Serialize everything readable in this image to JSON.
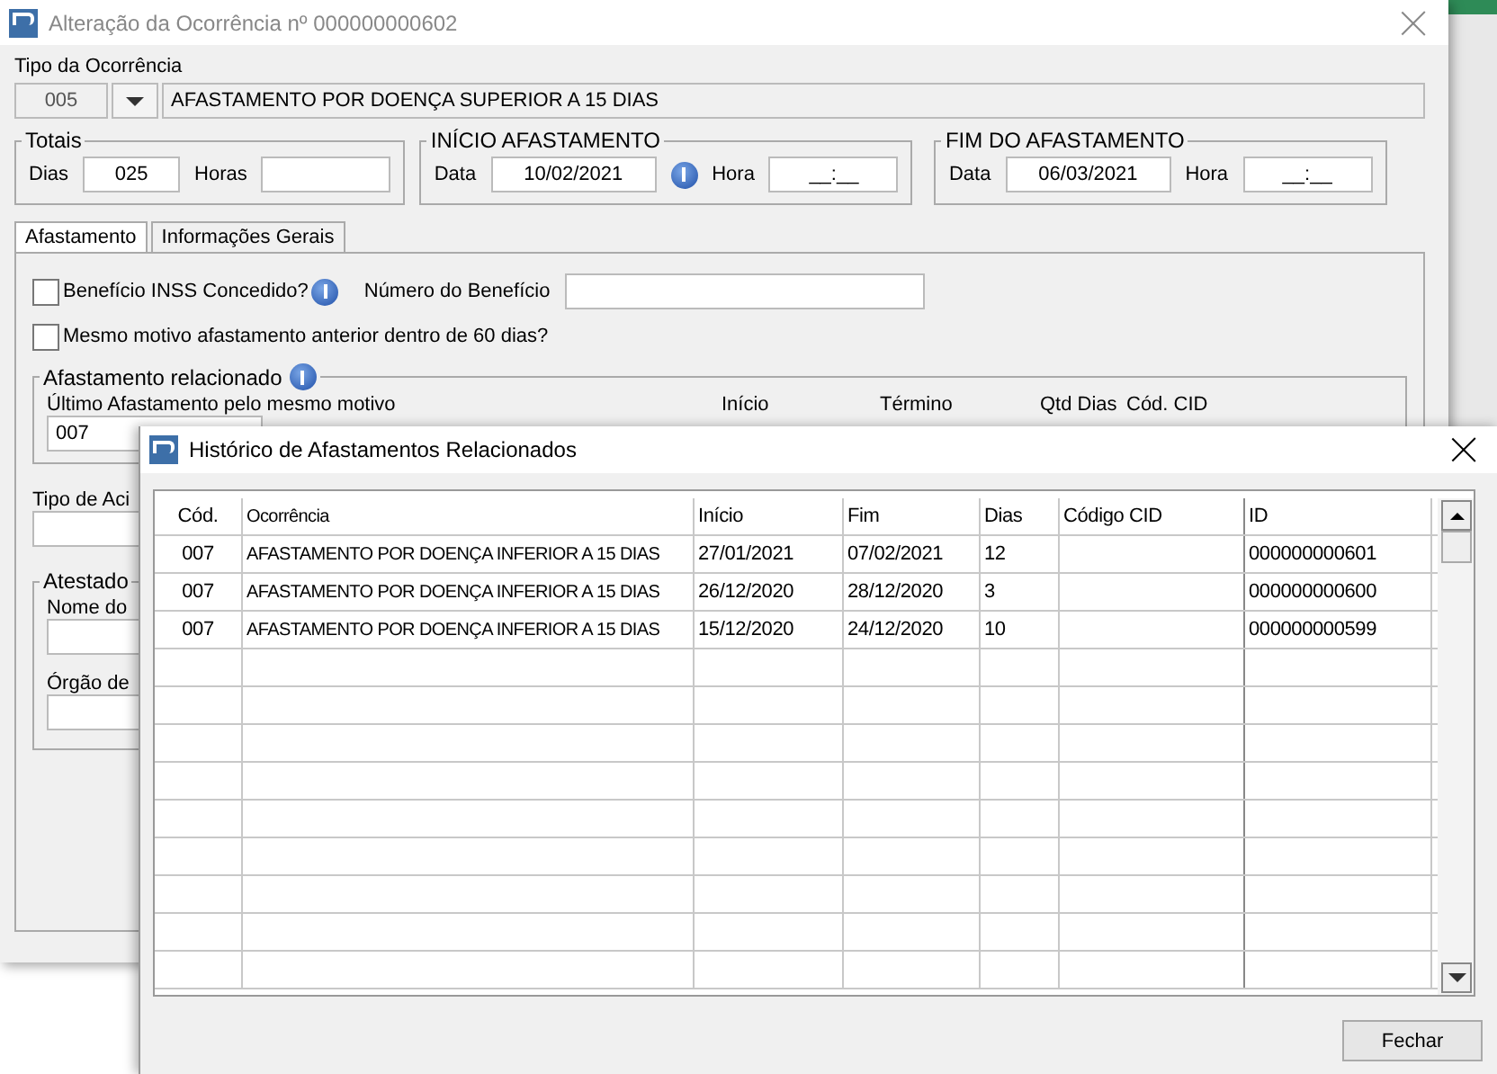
{
  "main_window": {
    "title": "Alteração da Ocorrência nº 000000000602",
    "tipo_label": "Tipo da Ocorrência",
    "tipo_code": "005",
    "tipo_description": "AFASTAMENTO POR DOENÇA SUPERIOR A 15 DIAS",
    "totais": {
      "legend": "Totais",
      "dias_label": "Dias",
      "dias": "025",
      "horas_label": "Horas"
    },
    "inicio": {
      "legend": "INÍCIO AFASTAMENTO",
      "data_label": "Data",
      "data": "10/02/2021",
      "hora_label": "Hora",
      "hora": "__:__"
    },
    "fim": {
      "legend": "FIM DO AFASTAMENTO",
      "data_label": "Data",
      "data": "06/03/2021",
      "hora_label": "Hora",
      "hora": "__:__"
    },
    "tabs": [
      {
        "label": "Afastamento",
        "selected": true
      },
      {
        "label": "Informações Gerais",
        "selected": false
      }
    ],
    "checks": [
      {
        "label": "Benefício INSS Concedido?",
        "checked": false
      },
      {
        "label": "Mesmo motivo afastamento anterior dentro de 60 dias?",
        "checked": false
      }
    ],
    "beneficio_label": "Número do Benefício",
    "relacionado": {
      "legend": "Afastamento relacionado",
      "ultimo_label": "Último Afastamento pelo mesmo motivo",
      "ultimo_code": "007",
      "columns": [
        "Início",
        "Término",
        "Qtd Dias",
        "Cód. CID"
      ]
    },
    "tipo_acid_label": "Tipo de Aci",
    "atestado": {
      "legend": "Atestado",
      "nome_label": "Nome do",
      "orgao_label": "Órgão de"
    }
  },
  "dialog": {
    "title": "Histórico de Afastamentos Relacionados",
    "columns": [
      "Cód.",
      "Ocorrência",
      "Início",
      "Fim",
      "Dias",
      "Código CID",
      "ID"
    ],
    "rows": [
      [
        "007",
        "AFASTAMENTO POR DOENÇA INFERIOR A 15 DIAS",
        "27/01/2021",
        "07/02/2021",
        "12",
        "",
        "000000000601"
      ],
      [
        "007",
        "AFASTAMENTO POR DOENÇA INFERIOR A 15 DIAS",
        "26/12/2020",
        "28/12/2020",
        "3",
        "",
        "000000000600"
      ],
      [
        "007",
        "AFASTAMENTO POR DOENÇA INFERIOR A 15 DIAS",
        "15/12/2020",
        "24/12/2020",
        "10",
        "",
        "000000000599"
      ]
    ],
    "close_button": "Fechar"
  }
}
